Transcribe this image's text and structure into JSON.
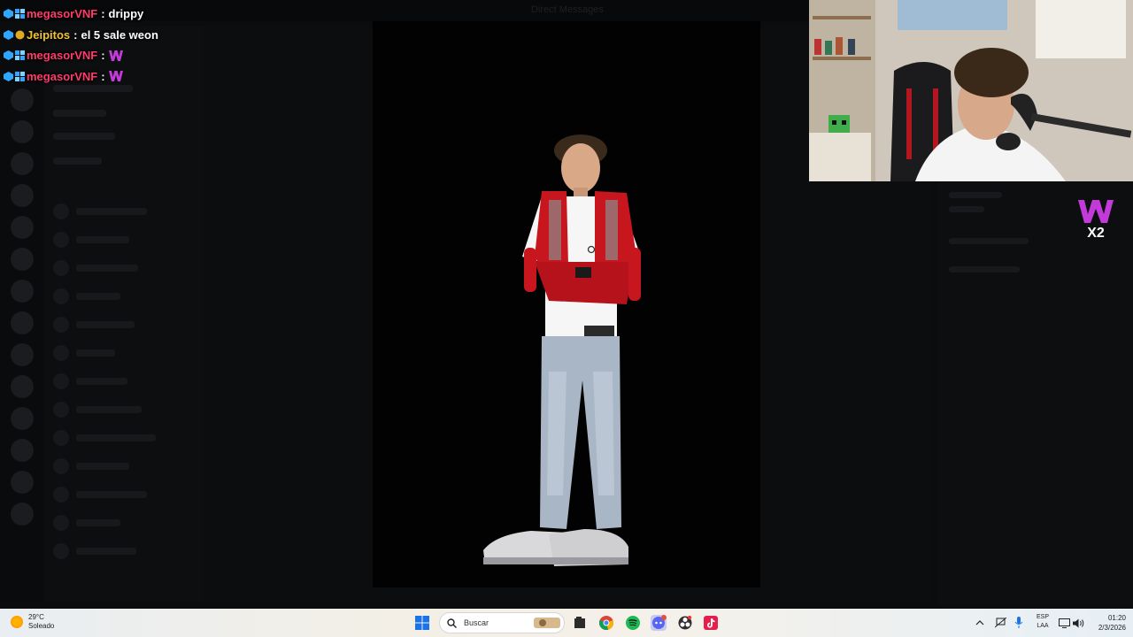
{
  "background": {
    "window_title": "Direct Messages"
  },
  "chat": {
    "messages": [
      {
        "user": "megasorVNF",
        "user_color": "#ff3b6b",
        "separator": ":",
        "text": "drippy",
        "emote": ""
      },
      {
        "user": "Jeipitos",
        "user_color": "#f1c232",
        "separator": ":",
        "text": "el 5 sale weon",
        "emote": ""
      },
      {
        "user": "megasorVNF",
        "user_color": "#ff3b6b",
        "separator": ":",
        "text": "",
        "emote": "w-emote"
      },
      {
        "user": "megasorVNF",
        "user_color": "#ff3b6b",
        "separator": ":",
        "text": "",
        "emote": "w-emote"
      }
    ]
  },
  "overlay": {
    "multiplier_label": "X2",
    "emote_letter": "W"
  },
  "taskbar": {
    "weather": {
      "temp": "29°C",
      "condition": "Soleado",
      "icon": "sun-icon"
    },
    "search_placeholder": "Buscar",
    "apps": [
      "windows-start-icon",
      "search-icon",
      "file-explorer-icon",
      "chrome-icon",
      "spotify-icon",
      "discord-icon",
      "obs-icon",
      "tiktok-icon"
    ],
    "tray": {
      "language_line1": "ESP",
      "language_line2": "LAA",
      "time": "01:20",
      "date": "2/3/2026"
    }
  },
  "colors": {
    "accent_red": "#d0202a",
    "chat_red": "#ff3b6b",
    "chat_gold": "#f1c232",
    "emote_purple": "#c23bd8"
  }
}
